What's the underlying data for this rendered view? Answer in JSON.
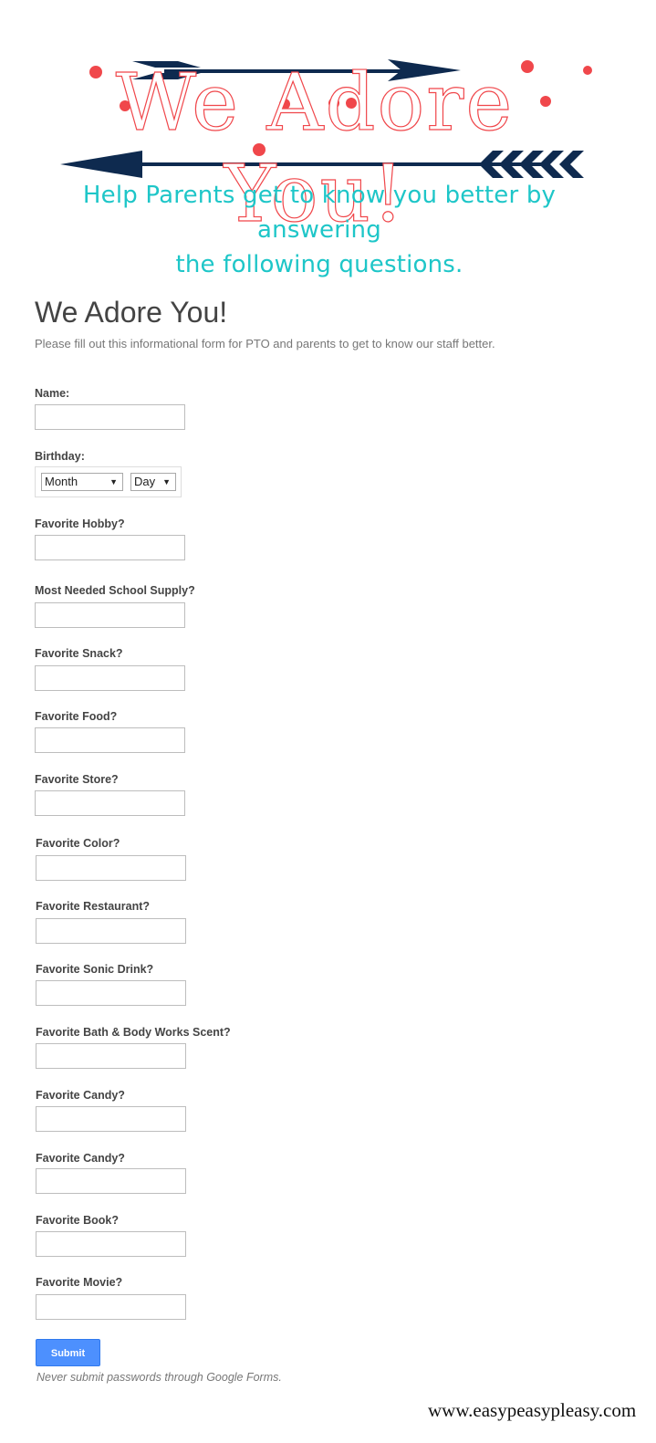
{
  "banner": {
    "title": "We Adore You!",
    "subtitle_line1": "Help Parents get to know you better by answering",
    "subtitle_line2": "the following questions.",
    "colors": {
      "title": "#f0474b",
      "subtitle": "#1ec6c8",
      "arrows": "#0e2a4f"
    },
    "icons": [
      "arrow-right-icon",
      "arrow-left-icon"
    ]
  },
  "form": {
    "title": "We Adore You!",
    "description": "Please fill out this informational form for PTO and parents to get to know our staff better.",
    "name_label": "Name:",
    "birthday_label": "Birthday:",
    "month_select": {
      "value": "Month"
    },
    "day_select": {
      "value": "Day"
    },
    "questions": [
      {
        "label": "Favorite Hobby?",
        "value": ""
      },
      {
        "label": "Most Needed School Supply?",
        "value": ""
      },
      {
        "label": "Favorite Snack?",
        "value": ""
      },
      {
        "label": "Favorite Food?",
        "value": ""
      },
      {
        "label": "Favorite Store?",
        "value": ""
      },
      {
        "label": "Favorite Color?",
        "value": ""
      },
      {
        "label": "Favorite Restaurant?",
        "value": ""
      },
      {
        "label": "Favorite Sonic Drink?",
        "value": ""
      },
      {
        "label": "Favorite Bath & Body Works Scent?",
        "value": ""
      },
      {
        "label": "Favorite Candy?",
        "value": ""
      },
      {
        "label": "Favorite Candy?",
        "value": ""
      },
      {
        "label": "Favorite Book?",
        "value": ""
      },
      {
        "label": "Favorite Movie?",
        "value": ""
      }
    ],
    "submit_label": "Submit",
    "submit_color": "#4d90fe",
    "note": "Never submit passwords through Google Forms."
  },
  "footer": {
    "credit": "www.easypeasypleasy.com"
  }
}
